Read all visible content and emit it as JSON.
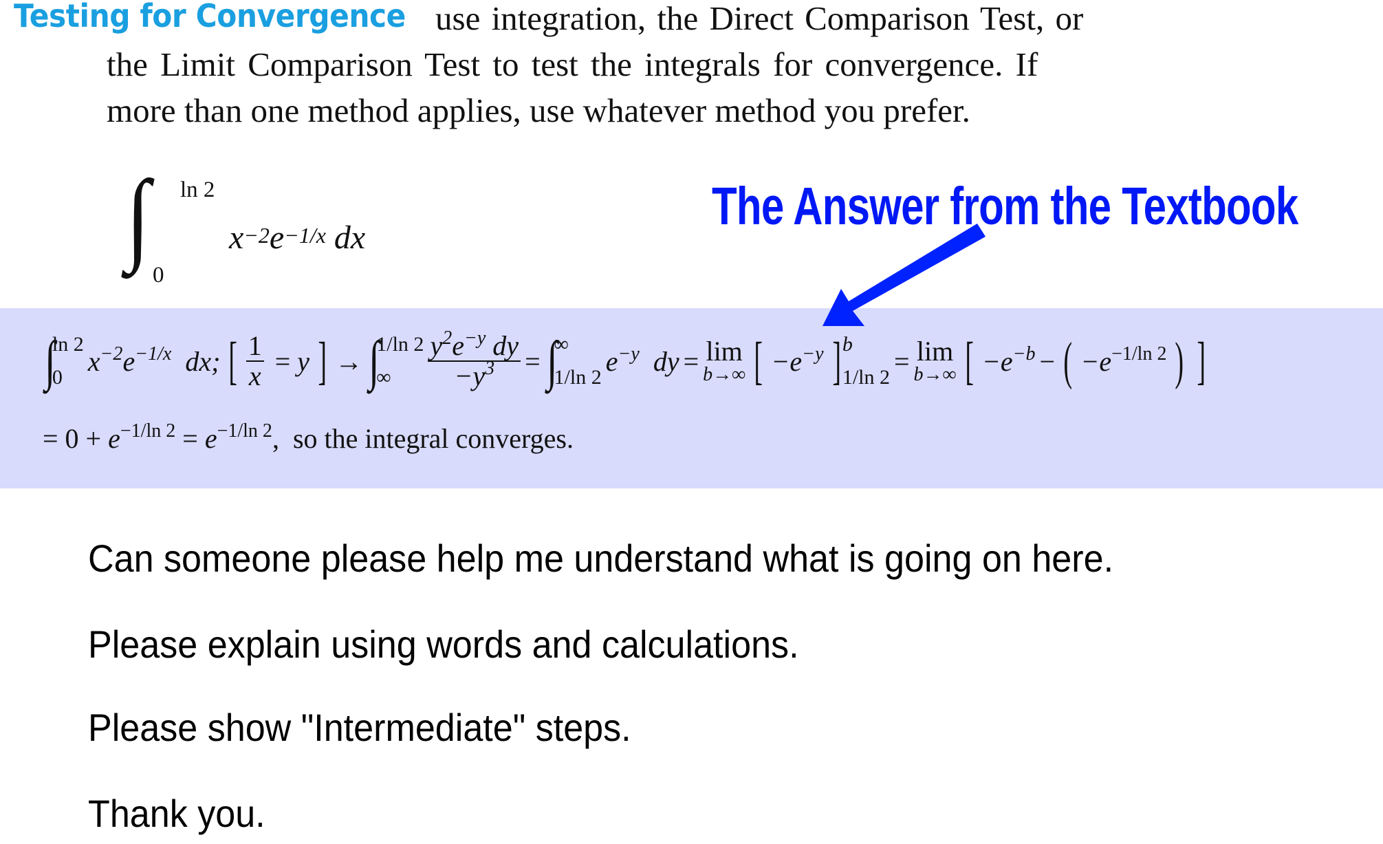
{
  "header": {
    "title": "Testing for Convergence",
    "title_color": "#1a9fe0"
  },
  "problem": {
    "lines": [
      "use integration, the Direct Comparison Test, or",
      "the Limit Comparison Test to test the integrals for convergence. If",
      "more than one method applies, use whatever method you prefer."
    ],
    "integral": {
      "upper": "ln 2",
      "lower": "0",
      "integrand": "x^(-2) e^(-1/x) dx"
    }
  },
  "annotation": {
    "label": "The Answer from the Textbook",
    "color": "#0018f5",
    "arrow_icon": "arrow-down-left-icon"
  },
  "answer": {
    "background": "#d8dbfc",
    "line1": "∫_0^{ln 2} x^{-2} e^{-1/x} dx; [1/x = y] → ∫_∞^{1/ln 2} (y^2 e^{-y} dy)/(-y^3) = ∫_{1/ln 2}^∞ e^{-y} dy = lim_{b→∞} [-e^{-y}]_{1/ln 2}^b = lim_{b→∞} [-e^{-b} - (-e^{-1/ln 2})]",
    "line2": "= 0 + e^{-1/ln 2} = e^{-1/ln 2}, so the integral converges.",
    "conclusion": "so the integral converges."
  },
  "question": {
    "lines": [
      "Can someone please help me understand what is going on here.",
      "Please explain using words and calculations.",
      "Please show \"Intermediate\" steps.",
      "Thank you."
    ]
  }
}
